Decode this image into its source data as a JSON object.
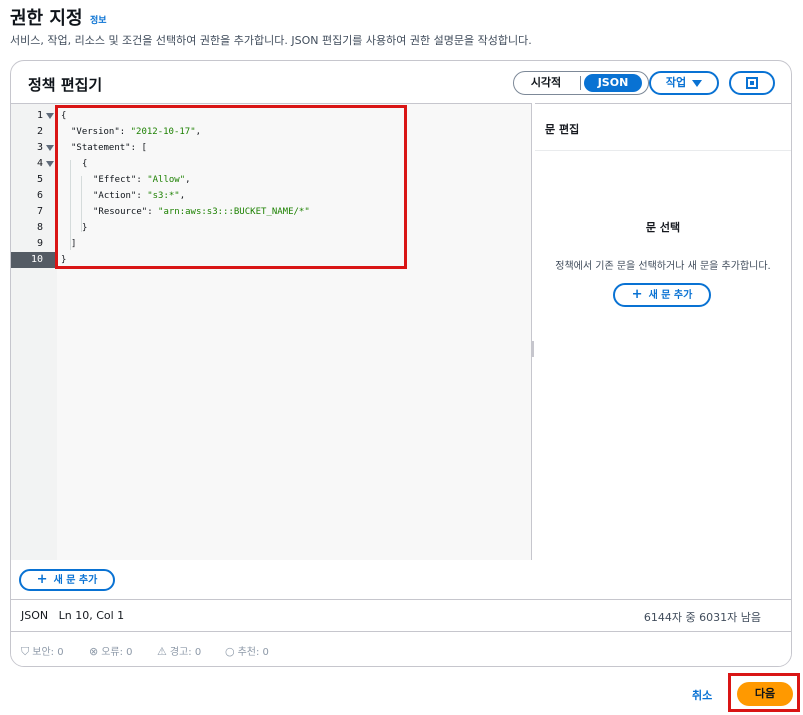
{
  "page": {
    "title": "권한 지정",
    "info_link": "정보",
    "subtitle": "서비스, 작업, 리소스 및 조건을 선택하여 권한을 추가합니다. JSON 편집기를 사용하여 권한 설명문을 작성합니다."
  },
  "editor_panel": {
    "title": "정책 편집기",
    "mode_toggle": {
      "visual": "시각적",
      "json": "JSON",
      "selected": "JSON"
    },
    "action_button": "작업",
    "fullscreen_icon": "fullscreen-icon"
  },
  "code": {
    "line_numbers": [
      "1",
      "2",
      "3",
      "4",
      "5",
      "6",
      "7",
      "8",
      "9",
      "10"
    ],
    "active_line": "10",
    "lines": [
      {
        "text": "{"
      },
      {
        "key": "\"Version\"",
        "sep": ": ",
        "value": "\"2012-10-17\"",
        "end": ","
      },
      {
        "key": "\"Statement\"",
        "sep": ": ",
        "value": "",
        "end": "["
      },
      {
        "text": "{"
      },
      {
        "key": "\"Effect\"",
        "sep": ": ",
        "value": "\"Allow\"",
        "end": ","
      },
      {
        "key": "\"Action\"",
        "sep": ": ",
        "value": "\"s3:*\"",
        "end": ","
      },
      {
        "key": "\"Resource\"",
        "sep": ": ",
        "value": "\"arn:aws:s3:::BUCKET_NAME/*\"",
        "end": ""
      },
      {
        "text": "}"
      },
      {
        "text": "]"
      },
      {
        "text": "}"
      }
    ]
  },
  "add_statement_button": "새 문 추가",
  "side_panel": {
    "title": "문 편집",
    "heading": "문 선택",
    "description": "정책에서 기존 문을 선택하거나 새 문을 추가합니다.",
    "add_button": "새 문 추가"
  },
  "status_bar": {
    "position": "JSON   Ln 10, Col 1",
    "chars_remaining": "6144자 중 6031자 남음"
  },
  "validation": {
    "security": "보안: 0",
    "errors": "오류: 0",
    "warnings": "경고: 0",
    "suggestions": "추천: 0"
  },
  "footer": {
    "cancel": "취소",
    "next": "다음"
  },
  "colors": {
    "accent": "#0972d3",
    "primary_button": "#ff9900",
    "highlight": "#d91515"
  }
}
